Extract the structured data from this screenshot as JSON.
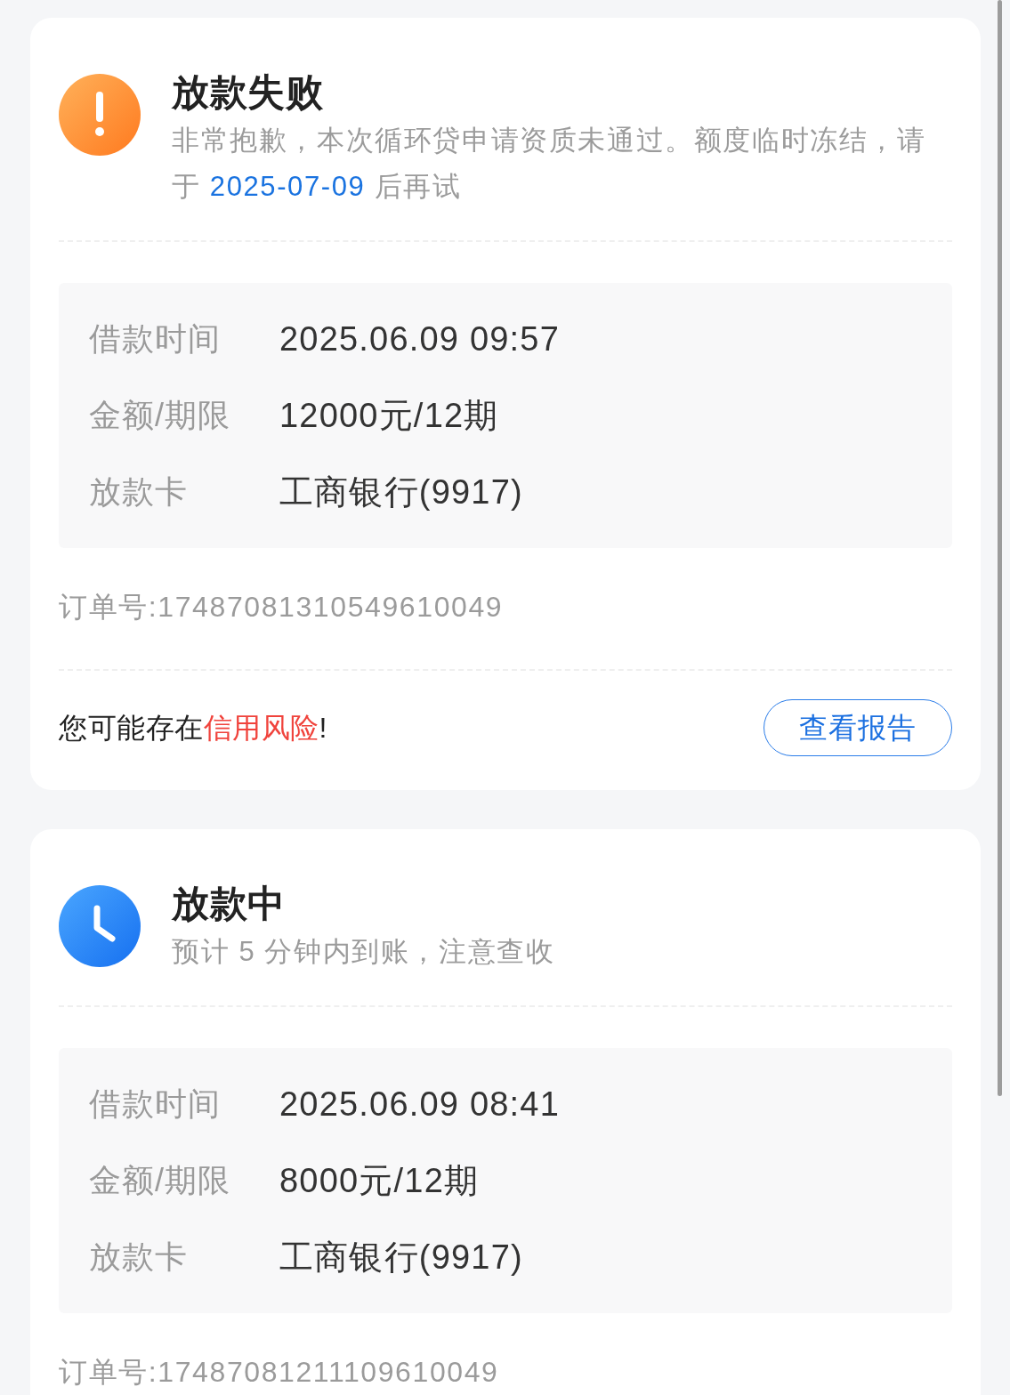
{
  "cards": [
    {
      "kind": "failed",
      "title": "放款失败",
      "message": [
        {
          "text": "非常抱歉，本次循环贷申请资质未通过。额度临时冻结，请于 ",
          "highlight": false
        },
        {
          "text": "2025-07-09",
          "highlight": true
        },
        {
          "text": " 后再试",
          "highlight": false
        }
      ],
      "details": [
        {
          "label": "借款时间",
          "value": "2025.06.09 09:57"
        },
        {
          "label": "金额/期限",
          "value": "12000元/12期"
        },
        {
          "label": "放款卡",
          "value": "工商银行(9917)"
        }
      ],
      "order_number": "订单号:17487081310549610049",
      "notice": [
        {
          "text": "您可能存在",
          "highlight": false
        },
        {
          "text": "信用风险",
          "highlight": true
        },
        {
          "text": "!",
          "highlight": false
        }
      ],
      "action_button": "查看报告"
    },
    {
      "kind": "pending",
      "title": "放款中",
      "message": [
        {
          "text": "预计 5 分钟内到账，注意查收",
          "highlight": false
        }
      ],
      "details": [
        {
          "label": "借款时间",
          "value": "2025.06.09 08:41"
        },
        {
          "label": "金额/期限",
          "value": "8000元/12期"
        },
        {
          "label": "放款卡",
          "value": "工商银行(9917)"
        }
      ],
      "order_number": "订单号:17487081211109610049"
    }
  ]
}
